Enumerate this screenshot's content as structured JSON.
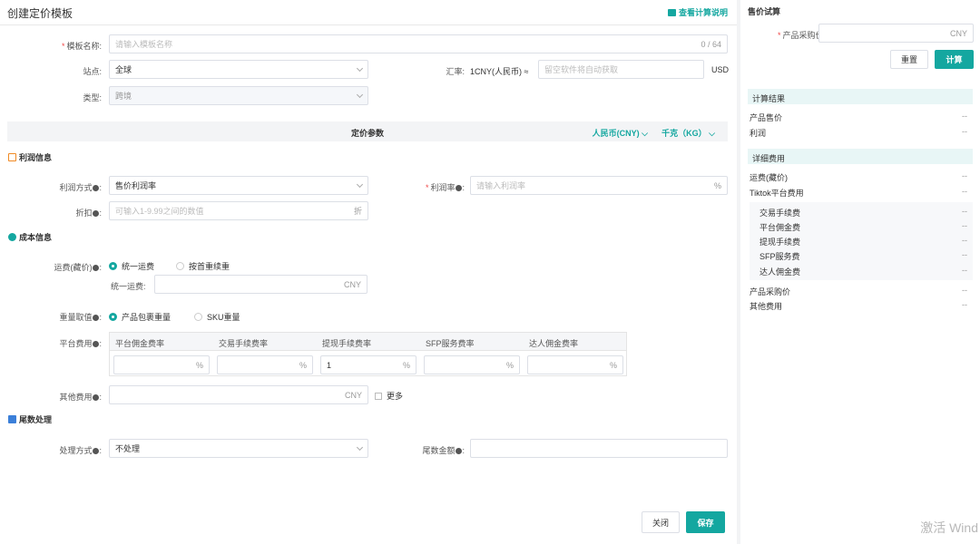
{
  "header": {
    "title": "创建定价模板",
    "help_link": "查看计算说明"
  },
  "form": {
    "template_name": {
      "label": "模板名称:",
      "placeholder": "请输入模板名称",
      "counter": "0 / 64"
    },
    "site": {
      "label": "站点:",
      "value": "全球"
    },
    "exchange": {
      "label": "汇率:",
      "prefix": "1CNY(人民币) ≈",
      "placeholder": "留空软件将自动获取",
      "suffix": "USD"
    },
    "type": {
      "label": "类型:",
      "value": "跨境"
    }
  },
  "params_bar": {
    "title": "定价参数",
    "currency": "人民币(CNY)",
    "unit": "千克（KG）"
  },
  "profit": {
    "section_title": "利润信息",
    "method": {
      "label": "利润方式",
      "value": "售价利润率"
    },
    "rate": {
      "label": "利润率",
      "placeholder": "请输入利润率",
      "suffix": "%"
    },
    "discount": {
      "label": "折扣",
      "placeholder": "可输入1-9.99之间的数值",
      "suffix": "折"
    }
  },
  "cost": {
    "section_title": "成本信息",
    "shipping": {
      "label": "运费(藏价)",
      "options": [
        "统一运费",
        "按首重续重"
      ],
      "selected_index": 0,
      "unified_label": "统一运费:",
      "unified_suffix": "CNY"
    },
    "weight": {
      "label": "重量取值",
      "options": [
        "产品包裹重量",
        "SKU重量"
      ],
      "selected_index": 0
    },
    "platform_fee": {
      "label": "平台费用",
      "columns": [
        {
          "header": "平台佣金费率",
          "value": "",
          "suffix": "%"
        },
        {
          "header": "交易手续费率",
          "value": "",
          "suffix": "%"
        },
        {
          "header": "提现手续费率",
          "value": "1",
          "suffix": "%"
        },
        {
          "header": "SFP服务费率",
          "value": "",
          "suffix": "%"
        },
        {
          "header": "达人佣金费率",
          "value": "",
          "suffix": "%"
        }
      ]
    },
    "other_fee": {
      "label": "其他费用",
      "suffix": "CNY",
      "more_label": "更多"
    }
  },
  "tail": {
    "section_title": "尾数处理",
    "method": {
      "label": "处理方式",
      "value": "不处理"
    },
    "amount": {
      "label": "尾数金额"
    }
  },
  "footer": {
    "close_label": "关闭",
    "save_label": "保存"
  },
  "sidebar": {
    "title": "售价试算",
    "purchase_label": "产品采购价:",
    "purchase_suffix": "CNY",
    "reset_label": "重置",
    "calc_label": "计算",
    "result_title": "计算结果",
    "results": [
      {
        "label": "产品售价",
        "value": "--"
      },
      {
        "label": "利润",
        "value": "--"
      }
    ],
    "detail_title": "详细费用",
    "details_top": [
      {
        "label": "运费(藏价)",
        "value": "--"
      },
      {
        "label": "Tiktok平台费用",
        "value": "--"
      }
    ],
    "details_sub": [
      {
        "label": "交易手续费",
        "value": "--"
      },
      {
        "label": "平台佣金费",
        "value": "--"
      },
      {
        "label": "提现手续费",
        "value": "--"
      },
      {
        "label": "SFP服务费",
        "value": "--"
      },
      {
        "label": "达人佣金费",
        "value": "--"
      }
    ],
    "details_bottom": [
      {
        "label": "产品采购价",
        "value": "--"
      },
      {
        "label": "其他费用",
        "value": "--"
      }
    ]
  },
  "watermark": "激活 Wind",
  "colors": {
    "accent": "#14a7a0",
    "required": "#f04848"
  }
}
